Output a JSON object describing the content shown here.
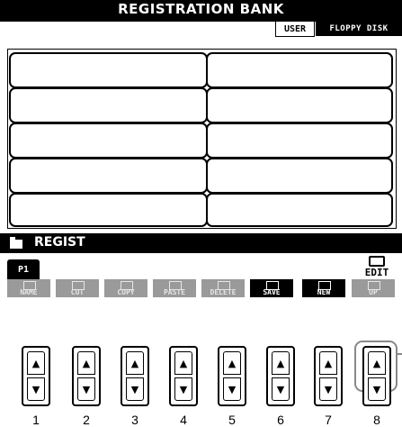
{
  "header": {
    "title": "REGISTRATION BANK",
    "tabs": [
      "USER",
      "FLOPPY DISK"
    ]
  },
  "path": {
    "label": "REGIST"
  },
  "page": {
    "label": "P1"
  },
  "edit": {
    "label": "EDIT"
  },
  "functions": [
    {
      "label": "NAME",
      "state": "disabled"
    },
    {
      "label": "CUT",
      "state": "disabled"
    },
    {
      "label": "COPY",
      "state": "disabled"
    },
    {
      "label": "PASTE",
      "state": "disabled"
    },
    {
      "label": "DELETE",
      "state": "disabled"
    },
    {
      "label": "SAVE",
      "state": "enabled"
    },
    {
      "label": "NEW",
      "state": "enabled"
    },
    {
      "label": "UP",
      "state": "disabled"
    }
  ],
  "buttons": [
    "1",
    "2",
    "3",
    "4",
    "5",
    "6",
    "7",
    "8"
  ],
  "highlight_button": "8"
}
